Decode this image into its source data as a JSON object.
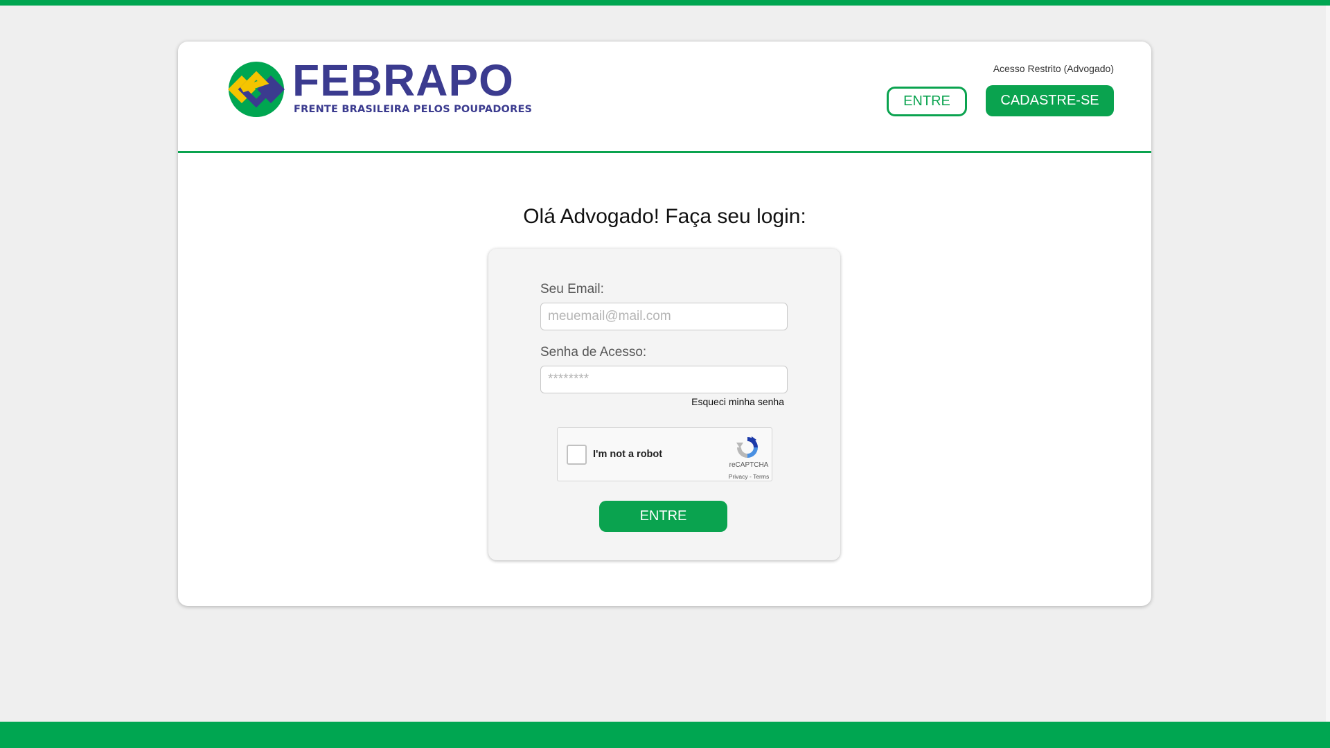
{
  "brand": {
    "name": "FEBRAPO",
    "tagline": "FRENTE BRASILEIRA PELOS POUPADORES",
    "colors": {
      "green": "#0aa34f",
      "navy": "#3b3b8f",
      "yellow": "#f5c400"
    }
  },
  "header": {
    "restricted_label": "Acesso Restrito (Advogado)",
    "login_button": "ENTRE",
    "register_button": "CADASTRE-SE"
  },
  "main": {
    "title": "Olá Advogado! Faça seu login:"
  },
  "form": {
    "email_label": "Seu Email:",
    "email_placeholder": "meuemail@mail.com",
    "email_value": "",
    "password_label": "Senha de Acesso:",
    "password_placeholder": "********",
    "password_value": "",
    "forgot_link": "Esqueci minha senha",
    "submit_button": "ENTRE"
  },
  "captcha": {
    "label": "I'm not a robot",
    "checked": false,
    "brand": "reCAPTCHA",
    "privacy_link": "Privacy",
    "separator": " - ",
    "terms_link": "Terms",
    "icon": "recaptcha-icon"
  }
}
